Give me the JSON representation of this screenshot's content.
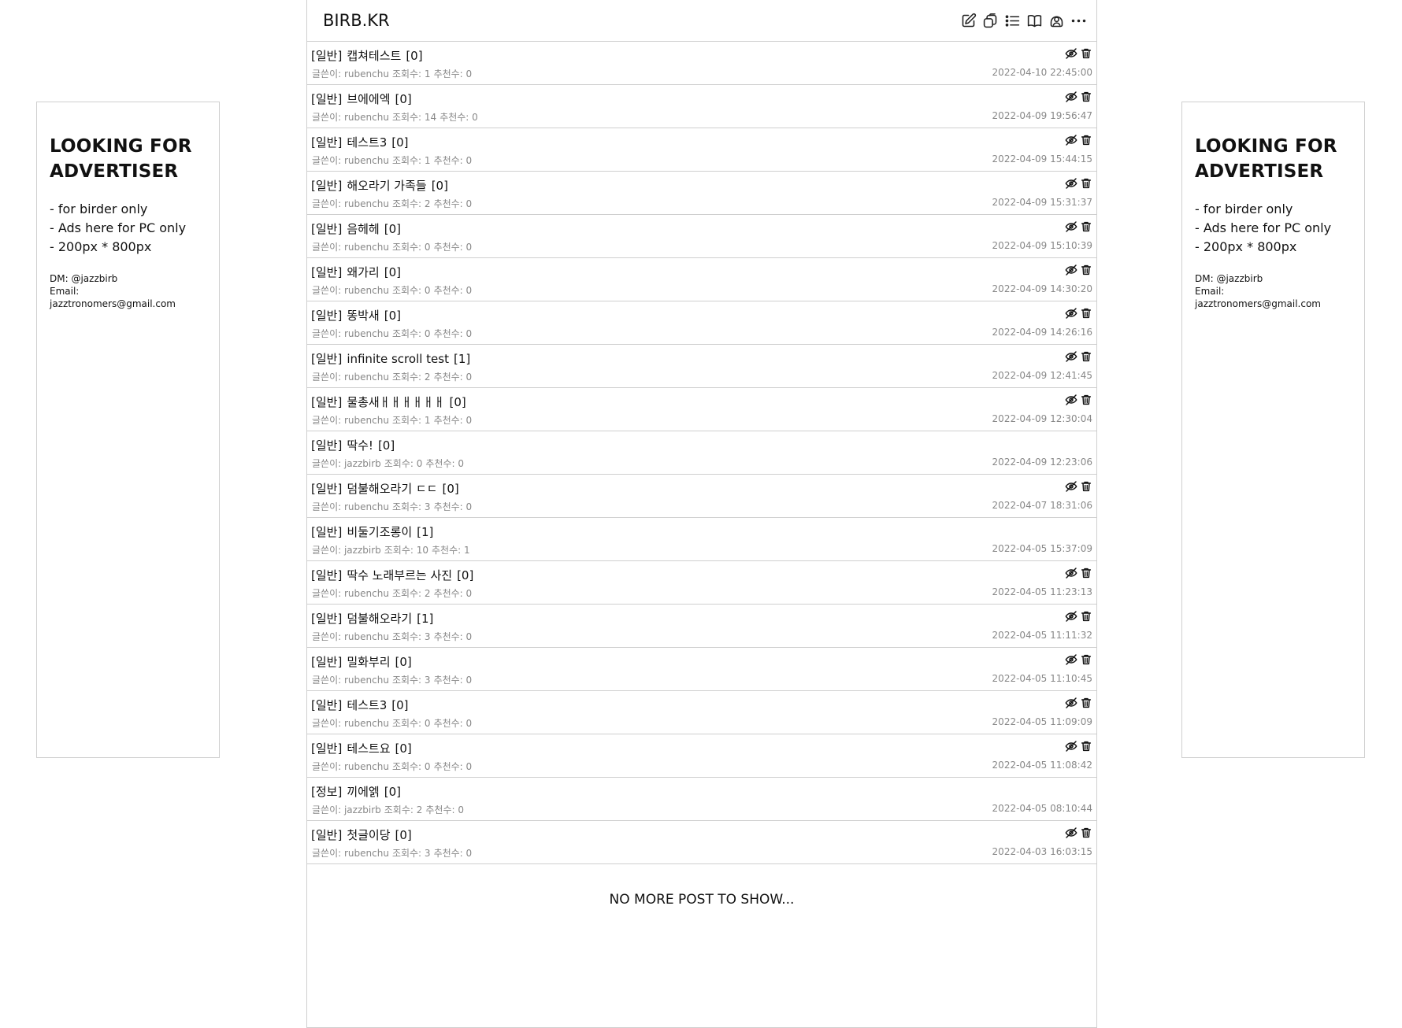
{
  "ads": {
    "left": {
      "title_line1": "LOOKING FOR",
      "title_line2": "ADVERTISER",
      "lines": [
        "- for birder only",
        "- Ads here for PC only",
        "- 200px * 800px"
      ],
      "dm": "DM: @jazzbirb",
      "email": "Email: jazztronomers@gmail.com"
    },
    "right": {
      "title_line1": "LOOKING FOR",
      "title_line2": "ADVERTISER",
      "lines": [
        "- for birder only",
        "- Ads here for PC only",
        "- 200px * 800px"
      ],
      "dm": "DM: @jazzbirb",
      "email": "Email: jazztronomers@gmail.com"
    }
  },
  "header": {
    "logo": "BIRB.KR",
    "icons": [
      "write-icon",
      "albums-icon",
      "list-icon",
      "book-icon",
      "account-icon",
      "more-icon"
    ]
  },
  "posts": [
    {
      "category": "[일반]",
      "title": "캡쳐테스트",
      "comments": "[0]",
      "author": "글쓴이: rubenchu",
      "views": "조회수: 1",
      "likes": "추천수: 0",
      "date": "2022-04-10 22:45:00",
      "actions": true
    },
    {
      "category": "[일반]",
      "title": "브에에엑",
      "comments": "[0]",
      "author": "글쓴이: rubenchu",
      "views": "조회수: 14",
      "likes": "추천수: 0",
      "date": "2022-04-09 19:56:47",
      "actions": true
    },
    {
      "category": "[일반]",
      "title": "테스트3",
      "comments": "[0]",
      "author": "글쓴이: rubenchu",
      "views": "조회수: 1",
      "likes": "추천수: 0",
      "date": "2022-04-09 15:44:15",
      "actions": true
    },
    {
      "category": "[일반]",
      "title": "해오라기 가족들",
      "comments": "[0]",
      "author": "글쓴이: rubenchu",
      "views": "조회수: 2",
      "likes": "추천수: 0",
      "date": "2022-04-09 15:31:37",
      "actions": true
    },
    {
      "category": "[일반]",
      "title": "음헤헤",
      "comments": "[0]",
      "author": "글쓴이: rubenchu",
      "views": "조회수: 0",
      "likes": "추천수: 0",
      "date": "2022-04-09 15:10:39",
      "actions": true
    },
    {
      "category": "[일반]",
      "title": "왜가리",
      "comments": "[0]",
      "author": "글쓴이: rubenchu",
      "views": "조회수: 0",
      "likes": "추천수: 0",
      "date": "2022-04-09 14:30:20",
      "actions": true
    },
    {
      "category": "[일반]",
      "title": "똥박새",
      "comments": "[0]",
      "author": "글쓴이: rubenchu",
      "views": "조회수: 0",
      "likes": "추천수: 0",
      "date": "2022-04-09 14:26:16",
      "actions": true
    },
    {
      "category": "[일반]",
      "title": "infinite scroll test",
      "comments": "[1]",
      "author": "글쓴이: rubenchu",
      "views": "조회수: 2",
      "likes": "추천수: 0",
      "date": "2022-04-09 12:41:45",
      "actions": true
    },
    {
      "category": "[일반]",
      "title": "물총새ㅐㅐㅐㅐㅐㅐ",
      "comments": "[0]",
      "author": "글쓴이: rubenchu",
      "views": "조회수: 1",
      "likes": "추천수: 0",
      "date": "2022-04-09 12:30:04",
      "actions": true
    },
    {
      "category": "[일반]",
      "title": "딱수!",
      "comments": "[0]",
      "author": "글쓴이: jazzbirb",
      "views": "조회수: 0",
      "likes": "추천수: 0",
      "date": "2022-04-09 12:23:06",
      "actions": false
    },
    {
      "category": "[일반]",
      "title": "덤불해오라기 ㄷㄷ",
      "comments": "[0]",
      "author": "글쓴이: rubenchu",
      "views": "조회수: 3",
      "likes": "추천수: 0",
      "date": "2022-04-07 18:31:06",
      "actions": true
    },
    {
      "category": "[일반]",
      "title": "비둘기조롱이",
      "comments": "[1]",
      "author": "글쓴이: jazzbirb",
      "views": "조회수: 10",
      "likes": "추천수: 1",
      "date": "2022-04-05 15:37:09",
      "actions": false
    },
    {
      "category": "[일반]",
      "title": "딱수 노래부르는 사진",
      "comments": "[0]",
      "author": "글쓴이: rubenchu",
      "views": "조회수: 2",
      "likes": "추천수: 0",
      "date": "2022-04-05 11:23:13",
      "actions": true
    },
    {
      "category": "[일반]",
      "title": "덤불해오라기",
      "comments": "[1]",
      "author": "글쓴이: rubenchu",
      "views": "조회수: 3",
      "likes": "추천수: 0",
      "date": "2022-04-05 11:11:32",
      "actions": true
    },
    {
      "category": "[일반]",
      "title": "밀화부리",
      "comments": "[0]",
      "author": "글쓴이: rubenchu",
      "views": "조회수: 3",
      "likes": "추천수: 0",
      "date": "2022-04-05 11:10:45",
      "actions": true
    },
    {
      "category": "[일반]",
      "title": "테스트3",
      "comments": "[0]",
      "author": "글쓴이: rubenchu",
      "views": "조회수: 0",
      "likes": "추천수: 0",
      "date": "2022-04-05 11:09:09",
      "actions": true
    },
    {
      "category": "[일반]",
      "title": "테스트요",
      "comments": "[0]",
      "author": "글쓴이: rubenchu",
      "views": "조회수: 0",
      "likes": "추천수: 0",
      "date": "2022-04-05 11:08:42",
      "actions": true
    },
    {
      "category": "[정보]",
      "title": "끼에엙",
      "comments": "[0]",
      "author": "글쓴이: jazzbirb",
      "views": "조회수: 2",
      "likes": "추천수: 0",
      "date": "2022-04-05 08:10:44",
      "actions": false
    },
    {
      "category": "[일반]",
      "title": "첫글이당",
      "comments": "[0]",
      "author": "글쓴이: rubenchu",
      "views": "조회수: 3",
      "likes": "추천수: 0",
      "date": "2022-04-03 16:03:15",
      "actions": true
    }
  ],
  "end_message": "NO MORE POST TO SHOW..."
}
